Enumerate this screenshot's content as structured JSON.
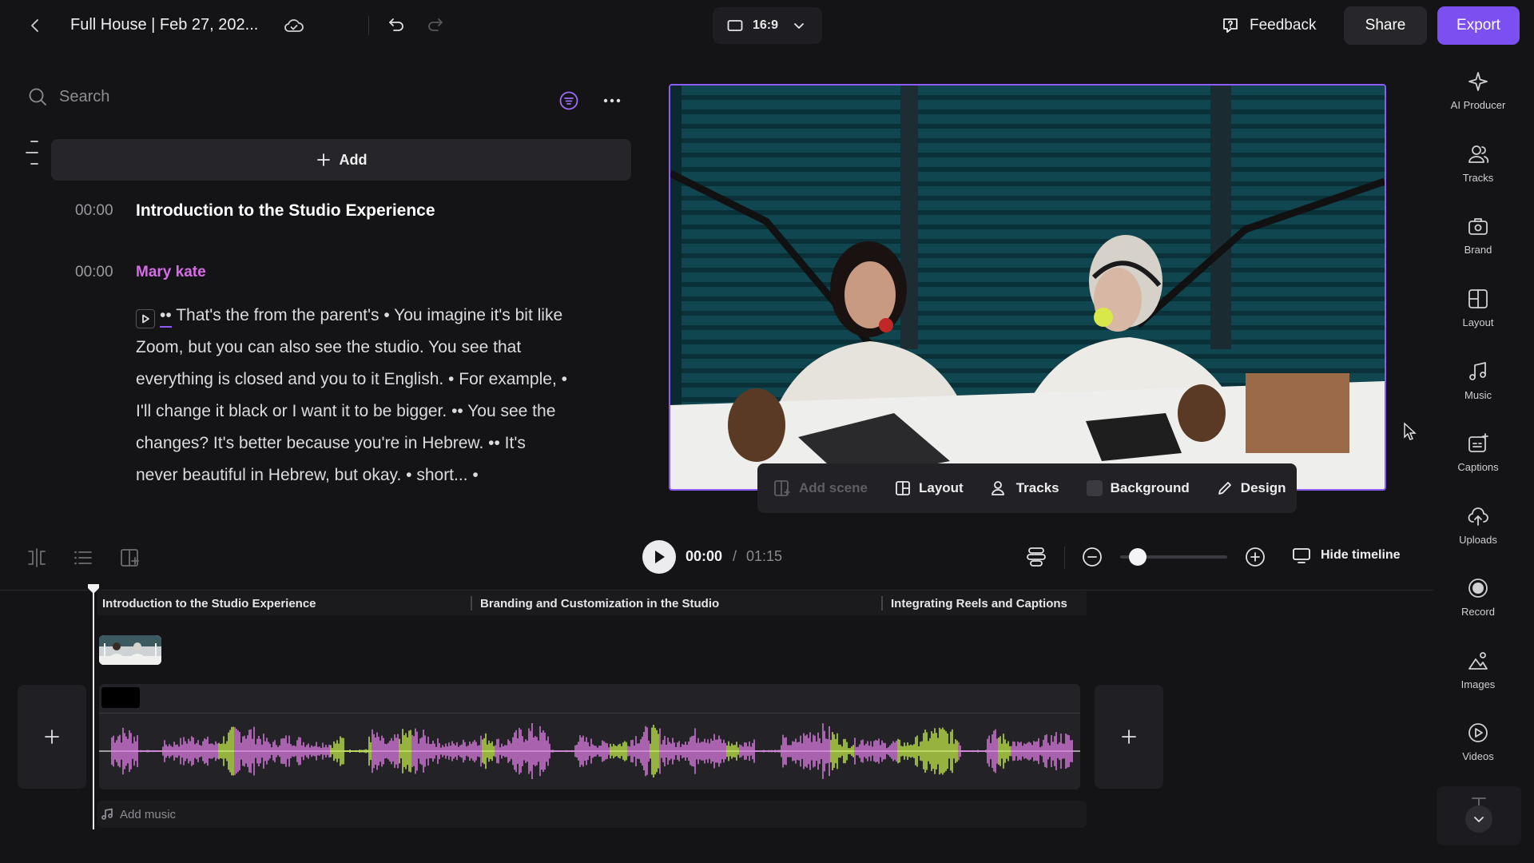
{
  "header": {
    "project_title": "Full House | Feb 27, 202...",
    "aspect_ratio": "16:9",
    "feedback_label": "Feedback",
    "share_label": "Share",
    "export_label": "Export"
  },
  "sidebar_left": {
    "search_placeholder": "Search",
    "add_label": "Add"
  },
  "transcript": {
    "scene_timestamp": "00:00",
    "scene_title": "Introduction to the Studio Experience",
    "speaker_timestamp": "00:00",
    "speaker_name": "Mary kate",
    "lead_dots": "••",
    "text": "That's the from the parent's • You imagine it's bit like Zoom, but you can also see the studio. You see that everything is closed and you to it English. • For example, • I'll change it black or I want it to be bigger. •• You see the changes? It's better because you're in Hebrew. •• It's never beautiful in Hebrew, but okay. • short... •"
  },
  "preview_toolbar": {
    "add_scene": "Add scene",
    "layout": "Layout",
    "tracks": "Tracks",
    "background": "Background",
    "design": "Design"
  },
  "right_rail": {
    "items": [
      {
        "label": "AI Producer",
        "icon": "sparkle-icon"
      },
      {
        "label": "Tracks",
        "icon": "users-icon"
      },
      {
        "label": "Brand",
        "icon": "brand-kit-icon"
      },
      {
        "label": "Layout",
        "icon": "layout-icon"
      },
      {
        "label": "Music",
        "icon": "music-note-icon"
      },
      {
        "label": "Captions",
        "icon": "captions-icon"
      },
      {
        "label": "Uploads",
        "icon": "upload-cloud-icon"
      },
      {
        "label": "Record",
        "icon": "record-icon"
      },
      {
        "label": "Images",
        "icon": "image-icon"
      },
      {
        "label": "Videos",
        "icon": "video-play-icon"
      }
    ]
  },
  "playback": {
    "current_time": "00:00",
    "separator": "/",
    "total_time": "01:15",
    "hide_timeline_label": "Hide timeline",
    "zoom_level": 0.1
  },
  "timeline": {
    "scenes": [
      "Introduction to the Studio Experience",
      "Branding and Customization in the Studio",
      "Integrating Reels and Captions"
    ],
    "add_music_label": "Add music"
  },
  "colors": {
    "accent": "#7c4ff0",
    "speaker": "#d56ee6",
    "wave_pink": "#e27ee8",
    "wave_lime": "#c8ef4a",
    "background": "#141416"
  }
}
